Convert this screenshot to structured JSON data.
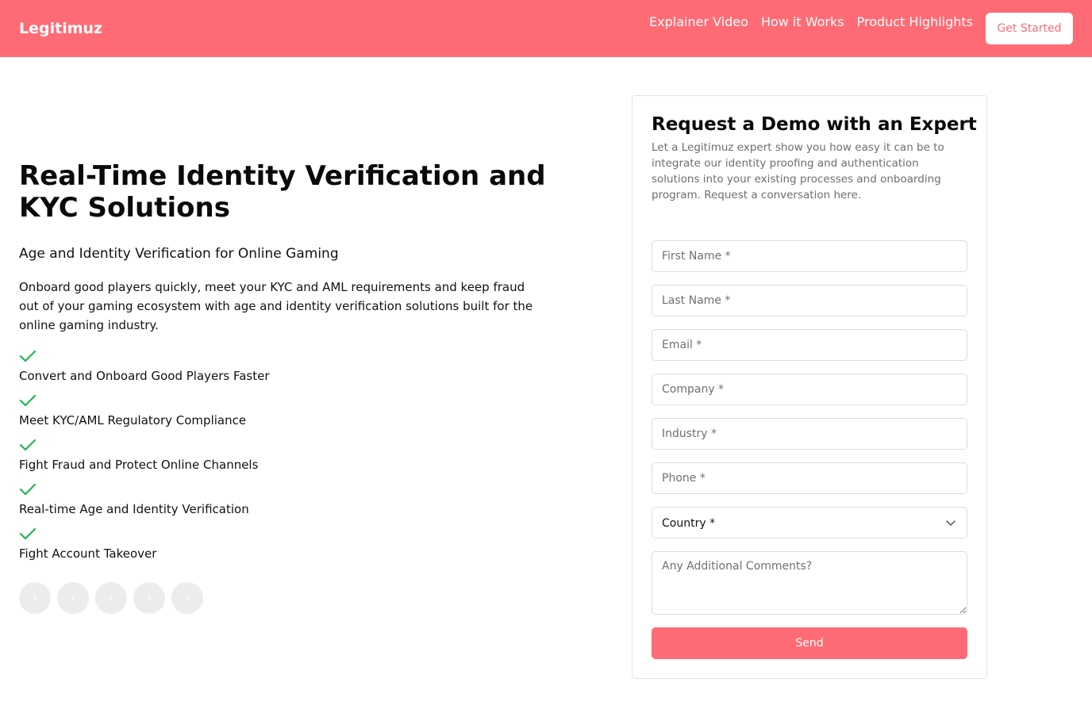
{
  "header": {
    "brand": "Legitimuz",
    "nav": [
      "Explainer Video",
      "How it Works",
      "Product Highlights"
    ],
    "cta_label": "Get Started"
  },
  "hero": {
    "title": "Real-Time Identity Verification and KYC Solutions",
    "subtitle": "Age and Identity Verification for Online Gaming",
    "description": "Onboard good players quickly, meet your KYC and AML requirements and keep fraud out of your gaming ecosystem with age and identity verification solutions built for the online gaming industry.",
    "features": [
      "Convert and Onboard Good Players Faster",
      "Meet KYC/AML Regulatory Compliance",
      "Fight Fraud and Protect Online Channels",
      "Real-time Age and Identity Verification",
      "Fight Account Takeover"
    ],
    "check_icon": "check-icon",
    "check_color": "#22b455"
  },
  "form": {
    "title": "Request a Demo with an Expert",
    "description": "Let a Legitimuz expert show you how easy it can be to integrate our identity proofing and authentication solutions into your existing processes and onboarding program. Request a conversation here.",
    "placeholders": {
      "first_name": "First Name *",
      "last_name": "Last Name *",
      "email": "Email *",
      "company": "Company *",
      "industry": "Industry *",
      "phone": "Phone *",
      "comments": "Any Additional Comments?"
    },
    "country_selected": "Country *",
    "send_label": "Send"
  },
  "colors": {
    "accent": "#ff6b75",
    "check": "#22b455"
  }
}
